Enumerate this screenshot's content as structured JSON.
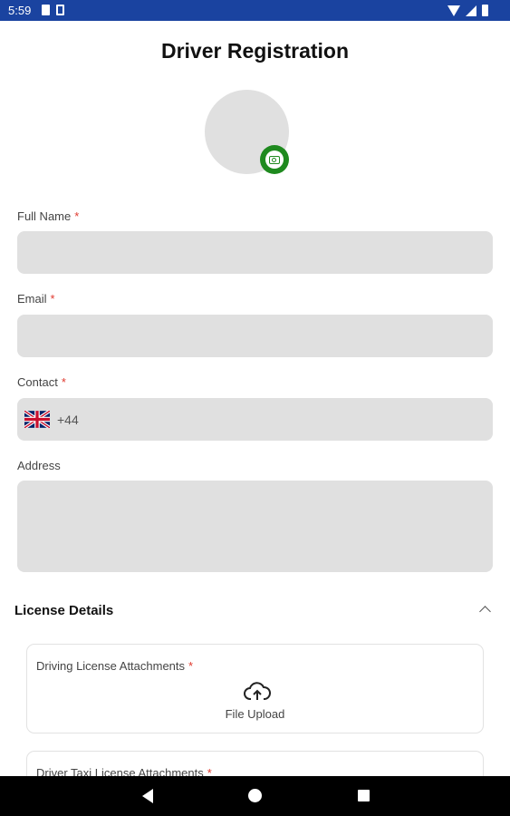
{
  "status_bar": {
    "time": "5:59"
  },
  "page_title": "Driver Registration",
  "form": {
    "full_name": {
      "label": "Full Name",
      "required": "*",
      "value": ""
    },
    "email": {
      "label": "Email",
      "required": "*",
      "value": ""
    },
    "contact": {
      "label": "Contact",
      "required": "*",
      "country_flag": "uk-flag-icon",
      "dial_code": "+44"
    },
    "address": {
      "label": "Address",
      "value": ""
    }
  },
  "license_section": {
    "title": "License Details",
    "cards": [
      {
        "label": "Driving License Attachments",
        "required": "*",
        "upload_label": "File Upload"
      },
      {
        "label": "Driver Taxi License Attachments",
        "required": "*"
      }
    ]
  },
  "colors": {
    "status_bar": "#1a43a0",
    "accent_green": "#1f8a1f",
    "required_star": "#e03a2f",
    "input_bg": "#e0e0e0"
  }
}
